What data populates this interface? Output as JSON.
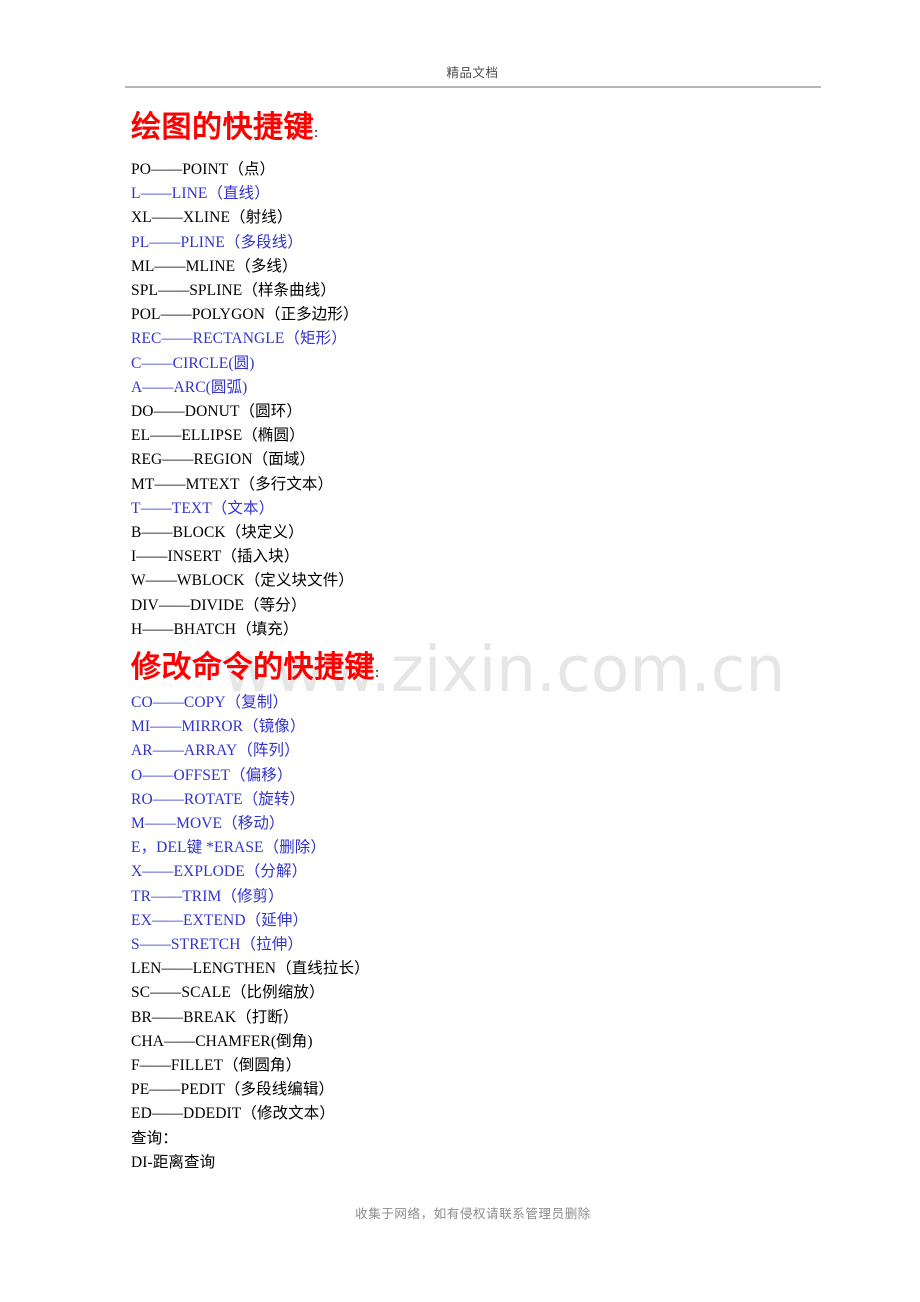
{
  "header": {
    "text": "精品文档"
  },
  "watermark": {
    "text": "www.zixin.com.cn"
  },
  "colors": {
    "heading_red": "#ff0000",
    "command_blue": "#3333cc",
    "body_black": "#000000",
    "header_gray": "#4a4a4a",
    "footer_gray": "#8c8c8c",
    "watermark_gray": "#e6e6e6",
    "rule_gray": "#b5b5b5"
  },
  "sections": [
    {
      "id": "drawing-shortcuts",
      "title": "绘图的快捷键",
      "title_suffix": ":",
      "items": [
        {
          "text": "PO——POINT（点）",
          "color": "black"
        },
        {
          "text": "L——LINE（直线）",
          "color": "blue"
        },
        {
          "text": "XL——XLINE（射线）",
          "color": "black"
        },
        {
          "text": "PL——PLINE（多段线）",
          "color": "blue"
        },
        {
          "text": "ML——MLINE（多线）",
          "color": "black"
        },
        {
          "text": "SPL——SPLINE（样条曲线）",
          "color": "black"
        },
        {
          "text": "POL——POLYGON（正多边形）",
          "color": "black"
        },
        {
          "text": "REC——RECTANGLE（矩形）",
          "color": "blue"
        },
        {
          "text": "C——CIRCLE(圆)",
          "color": "blue"
        },
        {
          "text": "A——ARC(圆弧)",
          "color": "blue"
        },
        {
          "text": "DO——DONUT（圆环）",
          "color": "black"
        },
        {
          "text": "EL——ELLIPSE（椭圆）",
          "color": "black"
        },
        {
          "text": "REG——REGION（面域）",
          "color": "black"
        },
        {
          "text": "MT——MTEXT（多行文本）",
          "color": "black"
        },
        {
          "text": "T——TEXT（文本）",
          "color": "blue"
        },
        {
          "text": "B——BLOCK（块定义）",
          "color": "black"
        },
        {
          "text": "I——INSERT（插入块）",
          "color": "black"
        },
        {
          "text": "W——WBLOCK（定义块文件）",
          "color": "black"
        },
        {
          "text": "DIV——DIVIDE（等分）",
          "color": "black"
        },
        {
          "text": "H——BHATCH（填充）",
          "color": "black"
        }
      ]
    },
    {
      "id": "modify-shortcuts",
      "title": "修改命令的快捷键",
      "title_suffix": ":",
      "items": [
        {
          "text": "CO——COPY（复制）",
          "color": "blue"
        },
        {
          "text": "MI——MIRROR（镜像）",
          "color": "blue"
        },
        {
          "text": "AR——ARRAY（阵列）",
          "color": "blue"
        },
        {
          "text": "O——OFFSET（偏移）",
          "color": "blue"
        },
        {
          "text": "RO——ROTATE（旋转）",
          "color": "blue"
        },
        {
          "text": "M——MOVE（移动）",
          "color": "blue"
        },
        {
          "text": "E，DEL键 *ERASE（删除）",
          "color": "blue"
        },
        {
          "text": "X——EXPLODE（分解）",
          "color": "blue"
        },
        {
          "text": "TR——TRIM（修剪）",
          "color": "blue"
        },
        {
          "text": "EX——EXTEND（延伸）",
          "color": "blue"
        },
        {
          "text": "S——STRETCH（拉伸）",
          "color": "blue"
        },
        {
          "text": "LEN——LENGTHEN（直线拉长）",
          "color": "black"
        },
        {
          "text": "SC——SCALE（比例缩放）",
          "color": "black"
        },
        {
          "text": "BR——BREAK（打断）",
          "color": "black"
        },
        {
          "text": "CHA——CHAMFER(倒角)",
          "color": "black"
        },
        {
          "text": "F——FILLET（倒圆角）",
          "color": "black"
        },
        {
          "text": "PE——PEDIT（多段线编辑）",
          "color": "black"
        },
        {
          "text": "ED——DDEDIT（修改文本）",
          "color": "black"
        },
        {
          "text": "查询：",
          "color": "black"
        },
        {
          "text": "DI-距离查询",
          "color": "black"
        }
      ]
    }
  ],
  "footer": {
    "text": "收集于网络，如有侵权请联系管理员删除"
  }
}
